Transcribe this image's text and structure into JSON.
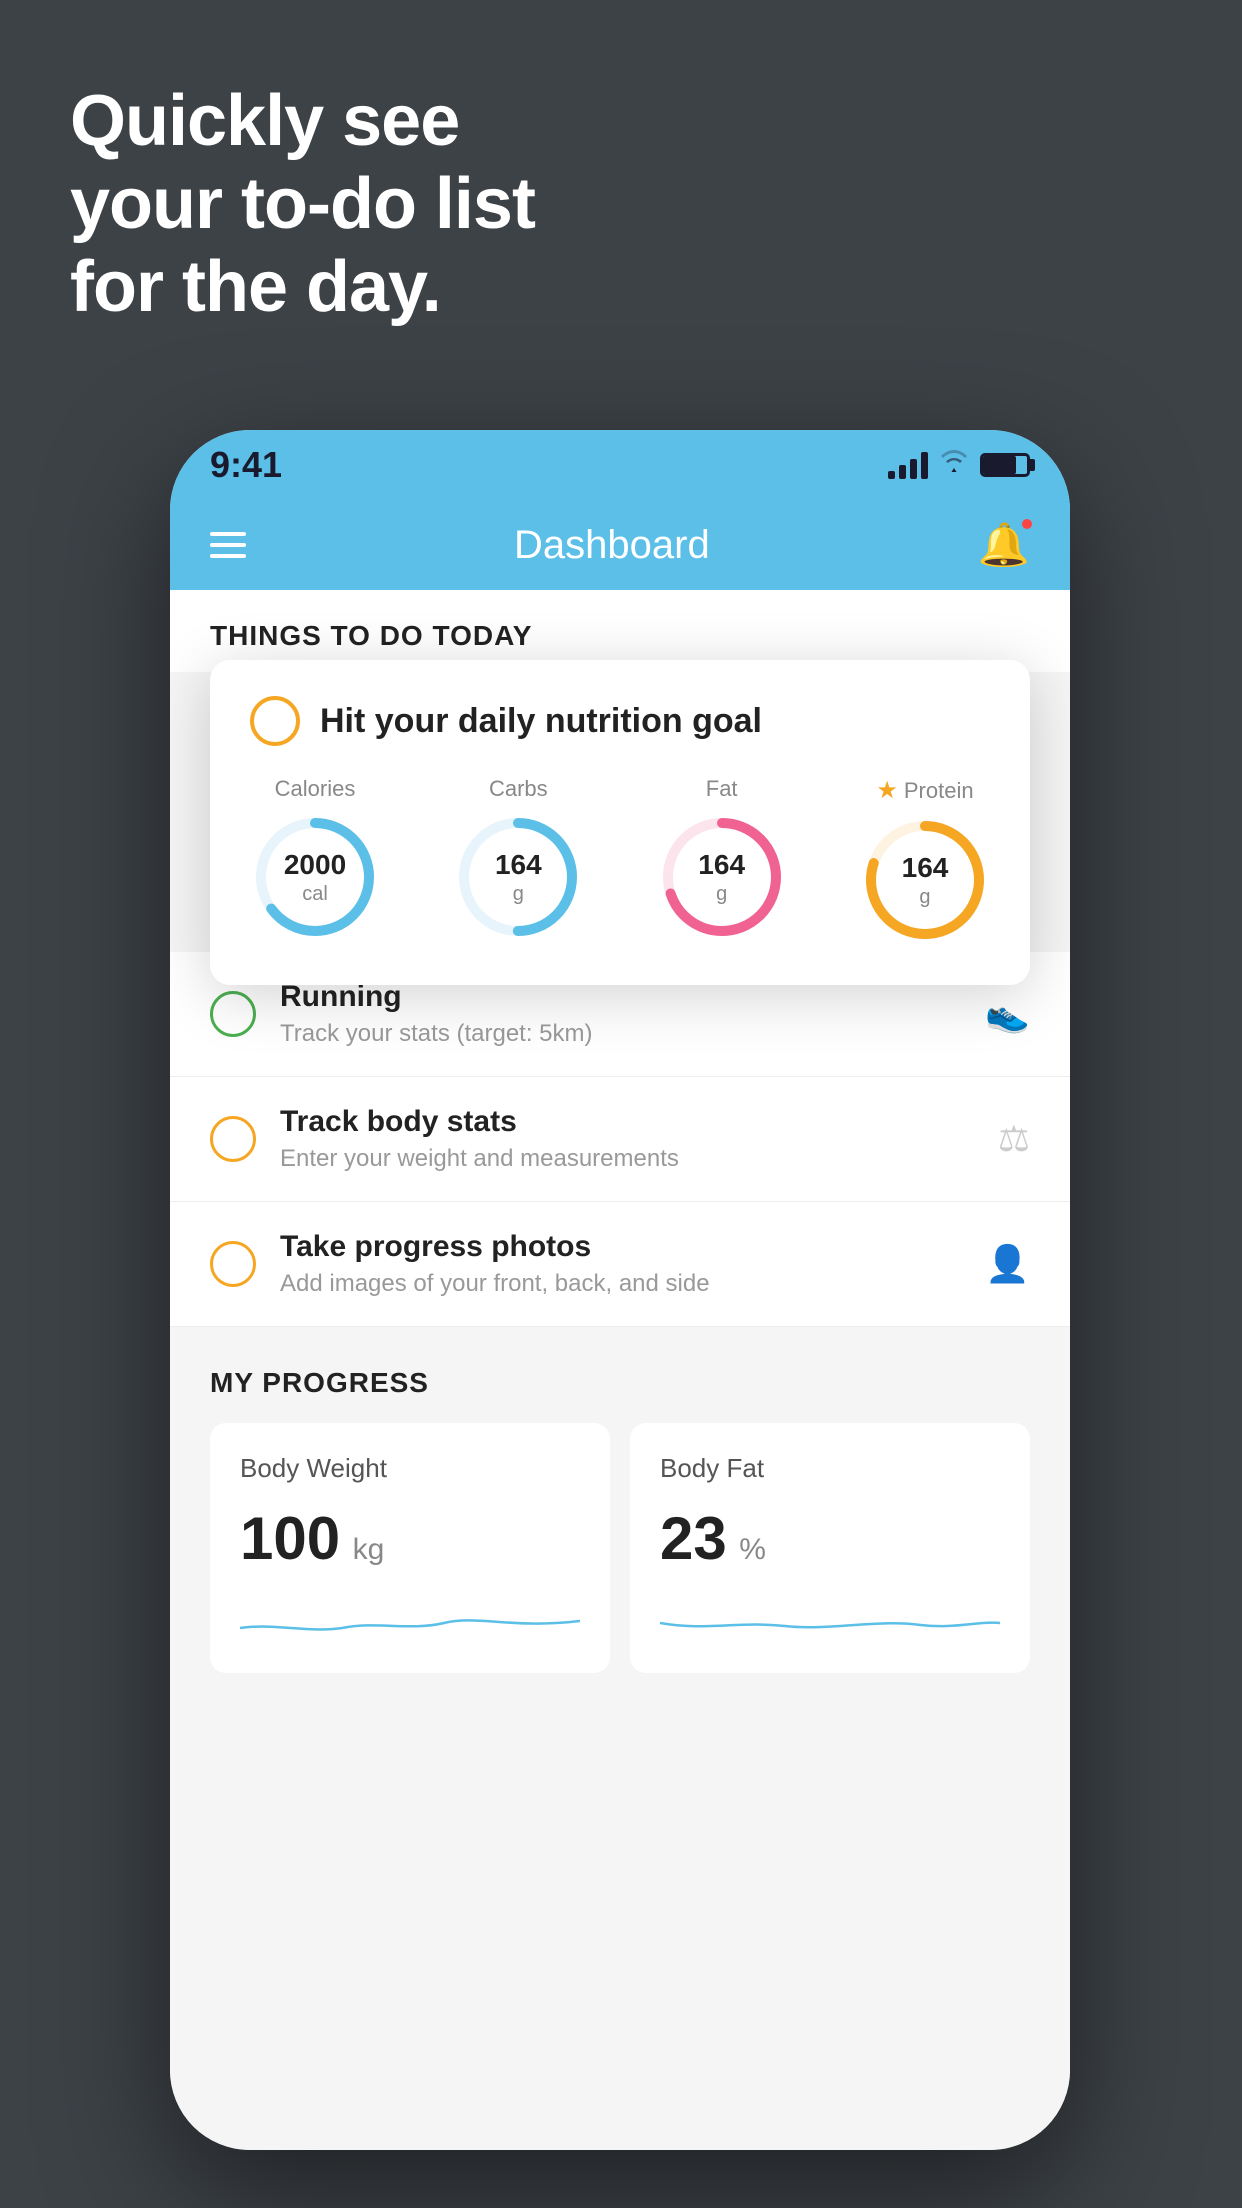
{
  "hero": {
    "line1": "Quickly see",
    "line2": "your to-do list",
    "line3": "for the day."
  },
  "phone": {
    "status_bar": {
      "time": "9:41"
    },
    "nav": {
      "title": "Dashboard"
    },
    "section": {
      "things_title": "THINGS TO DO TODAY"
    },
    "nutrition_card": {
      "title": "Hit your daily nutrition goal",
      "metrics": [
        {
          "label": "Calories",
          "value": "2000",
          "unit": "cal",
          "color": "#5bbfe8",
          "pct": 65
        },
        {
          "label": "Carbs",
          "value": "164",
          "unit": "g",
          "color": "#5bbfe8",
          "pct": 50
        },
        {
          "label": "Fat",
          "value": "164",
          "unit": "g",
          "color": "#f06292",
          "pct": 70
        },
        {
          "label": "Protein",
          "value": "164",
          "unit": "g",
          "color": "#f5a623",
          "pct": 80,
          "starred": true
        }
      ]
    },
    "todo_items": [
      {
        "title": "Running",
        "subtitle": "Track your stats (target: 5km)",
        "circle": "green",
        "icon": "🏃"
      },
      {
        "title": "Track body stats",
        "subtitle": "Enter your weight and measurements",
        "circle": "yellow",
        "icon": "⚖"
      },
      {
        "title": "Take progress photos",
        "subtitle": "Add images of your front, back, and side",
        "circle": "yellow",
        "icon": "👤"
      }
    ],
    "progress": {
      "title": "MY PROGRESS",
      "cards": [
        {
          "title": "Body Weight",
          "value": "100",
          "unit": "kg"
        },
        {
          "title": "Body Fat",
          "value": "23",
          "unit": "%"
        }
      ]
    }
  }
}
